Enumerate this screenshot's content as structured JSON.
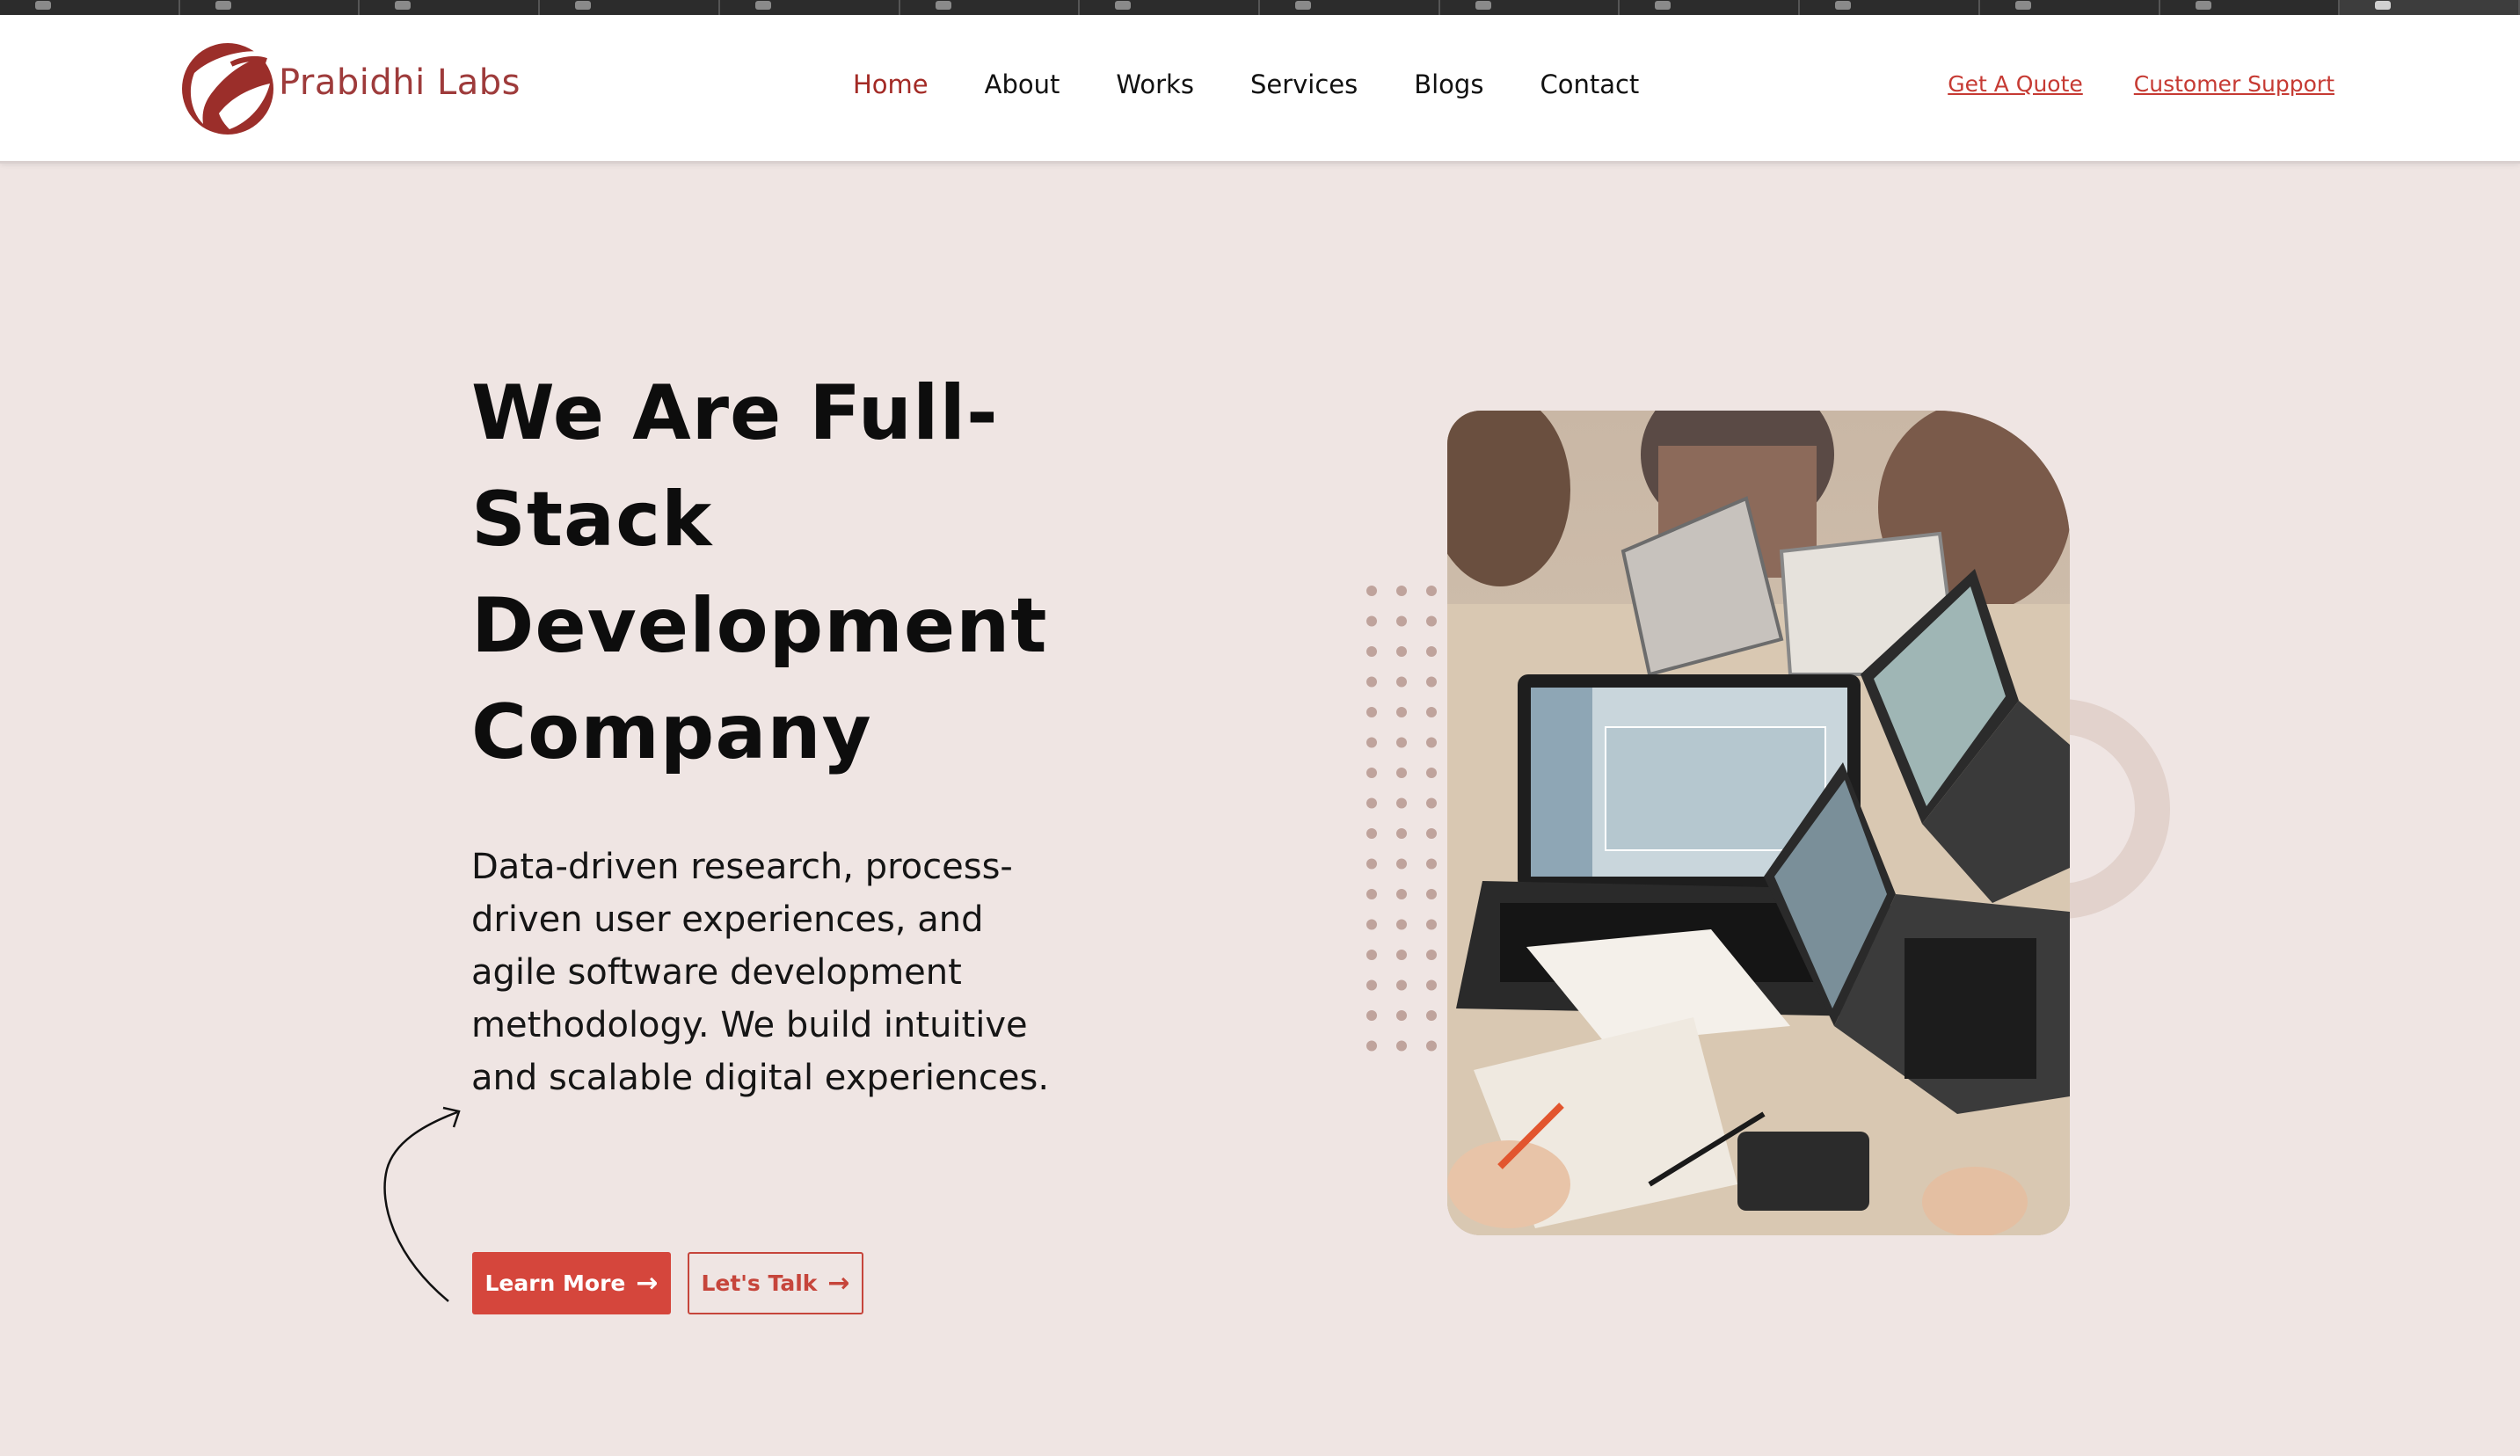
{
  "brand": {
    "name": "Prabidhi Labs",
    "accent_color": "#a32a25",
    "button_color": "#d5463c",
    "background_color": "#efe5e3"
  },
  "nav": {
    "items": [
      {
        "label": "Home",
        "active": true
      },
      {
        "label": "About",
        "active": false
      },
      {
        "label": "Works",
        "active": false
      },
      {
        "label": "Services",
        "active": false
      },
      {
        "label": "Blogs",
        "active": false
      },
      {
        "label": "Contact",
        "active": false
      }
    ]
  },
  "top_links": {
    "quote": "Get A Quote",
    "support": "Customer Support"
  },
  "hero": {
    "title_lines": [
      "We Are Full-",
      "Stack",
      "Development",
      "Company"
    ],
    "description": "Data-driven research, process-driven user experiences, and agile software development methodology. We build intuitive and scalable digital experiences.",
    "learn_more": "Learn More",
    "lets_talk": "Let's Talk",
    "arrow_icon": "arrow-right-icon"
  },
  "hero_image": {
    "subject": "team-working-on-laptops-photo"
  }
}
